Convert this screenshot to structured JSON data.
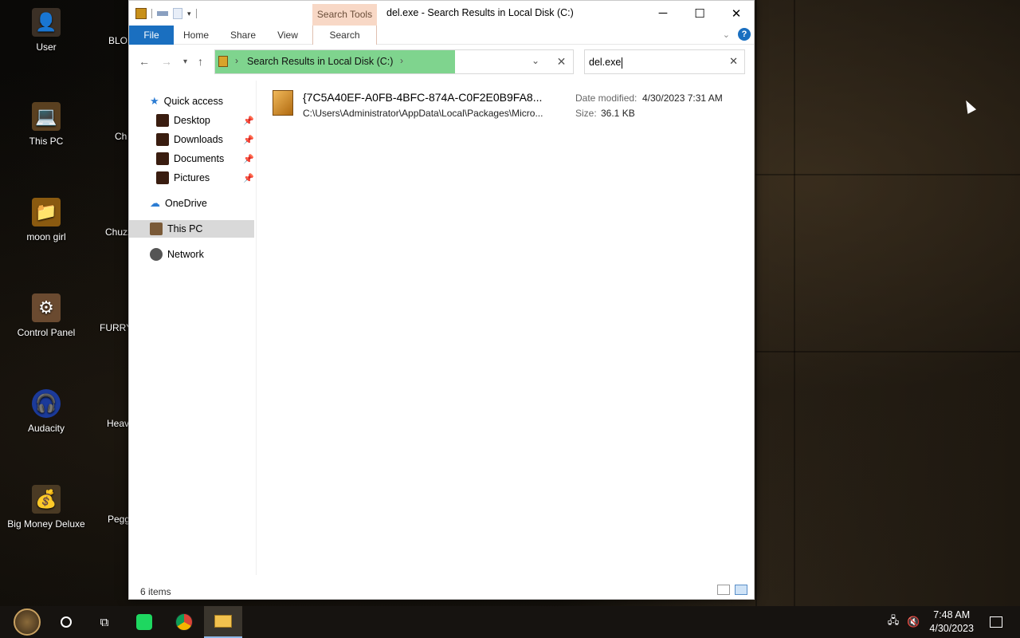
{
  "desktop": {
    "icons": [
      {
        "label": "User",
        "glyph": "👤"
      },
      {
        "label": "This PC",
        "glyph": "💻"
      },
      {
        "label": "moon girl",
        "glyph": "📁"
      },
      {
        "label": "Control Panel",
        "glyph": "⚙"
      },
      {
        "label": "Audacity",
        "glyph": "🎧"
      },
      {
        "label": "Big Money Deluxe",
        "glyph": "💰"
      }
    ],
    "partial_icons": [
      {
        "label": "BLO"
      },
      {
        "label": "Ch"
      },
      {
        "label": "Chuzz"
      },
      {
        "label": "FURRY"
      },
      {
        "label": "Heav"
      },
      {
        "label": "Pegg"
      }
    ]
  },
  "window": {
    "title": "del.exe - Search Results in Local Disk (C:)",
    "contextual_tab": "Search Tools",
    "tabs": [
      "File",
      "Home",
      "Share",
      "View",
      "Search"
    ],
    "controls": {
      "minimize": "─",
      "maximize": "☐",
      "close": "✕"
    },
    "help": "?"
  },
  "address": {
    "path": "Search Results in Local Disk (C:)",
    "search_value": "del.exe",
    "progress": 0.67
  },
  "nav": {
    "quick_access": "Quick access",
    "items": [
      "Desktop",
      "Downloads",
      "Documents",
      "Pictures"
    ],
    "onedrive": "OneDrive",
    "this_pc": "This PC",
    "network": "Network"
  },
  "results": [
    {
      "name": "{7C5A40EF-A0FB-4BFC-874A-C0F2E0B9FA8...",
      "path": "C:\\Users\\Administrator\\AppData\\Local\\Packages\\Micro...",
      "date_label": "Date modified:",
      "date_value": "4/30/2023 7:31 AM",
      "size_label": "Size:",
      "size_value": "36.1 KB"
    }
  ],
  "status": {
    "count": "6 items"
  },
  "taskbar": {
    "time": "7:48 AM",
    "date": "4/30/2023"
  },
  "colors": {
    "accent": "#1a6fc0",
    "search_tools": "#f8d8c6",
    "progress": "#7fd48e",
    "selection": "#d9d9d9"
  }
}
